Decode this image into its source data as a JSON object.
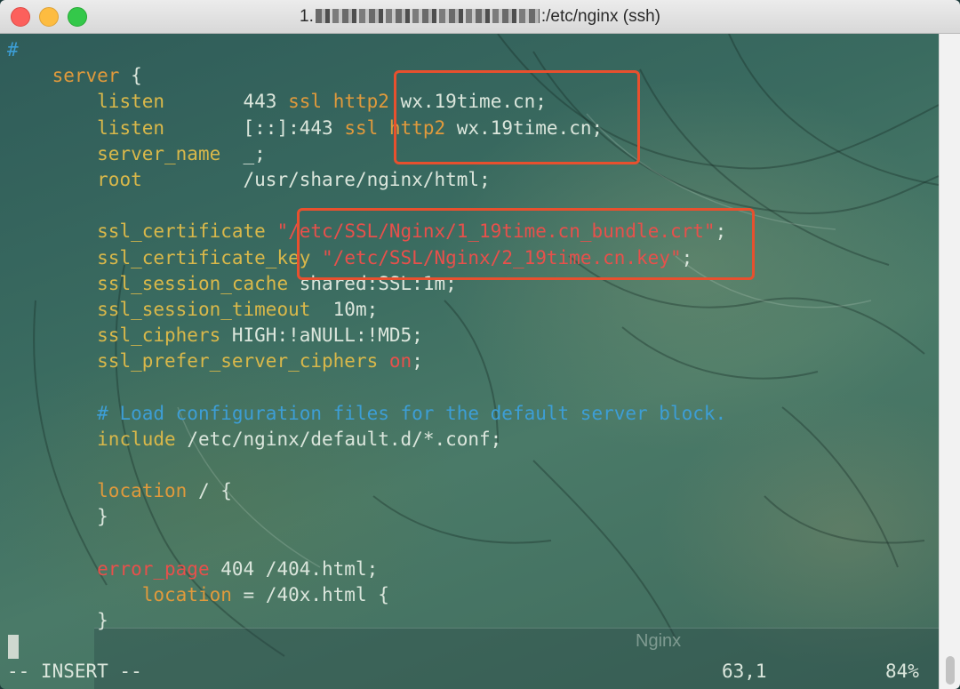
{
  "window": {
    "title_prefix": "1.",
    "title_suffix": ":/etc/nginx (ssh)"
  },
  "editor": {
    "lines": [
      [
        {
          "t": "#",
          "c": "hash"
        }
      ],
      [
        {
          "t": "    "
        },
        {
          "t": "server",
          "c": "kw"
        },
        {
          "t": " {"
        }
      ],
      [
        {
          "t": "        "
        },
        {
          "t": "listen",
          "c": "dir"
        },
        {
          "t": "       443 "
        },
        {
          "t": "ssl",
          "c": "kw"
        },
        {
          "t": " "
        },
        {
          "t": "http2",
          "c": "kw"
        },
        {
          "t": " wx.19time.cn;"
        }
      ],
      [
        {
          "t": "        "
        },
        {
          "t": "listen",
          "c": "dir"
        },
        {
          "t": "       [::]:443 "
        },
        {
          "t": "ssl",
          "c": "kw"
        },
        {
          "t": " "
        },
        {
          "t": "http2",
          "c": "kw"
        },
        {
          "t": " wx.19time.cn;"
        }
      ],
      [
        {
          "t": "        "
        },
        {
          "t": "server_name",
          "c": "dir"
        },
        {
          "t": "  _;"
        }
      ],
      [
        {
          "t": "        "
        },
        {
          "t": "root",
          "c": "dir"
        },
        {
          "t": "         /usr/share/nginx/html;"
        }
      ],
      [
        {
          "t": ""
        }
      ],
      [
        {
          "t": "        "
        },
        {
          "t": "ssl_certificate",
          "c": "dir"
        },
        {
          "t": " "
        },
        {
          "t": "\"/etc/SSL/Nginx/1_19time.cn_bundle.crt\"",
          "c": "str"
        },
        {
          "t": ";"
        }
      ],
      [
        {
          "t": "        "
        },
        {
          "t": "ssl_certificate_key",
          "c": "dir"
        },
        {
          "t": " "
        },
        {
          "t": "\"/etc/SSL/Nginx/2_19time.cn.key\"",
          "c": "str"
        },
        {
          "t": ";"
        }
      ],
      [
        {
          "t": "        "
        },
        {
          "t": "ssl_session_cache",
          "c": "dir"
        },
        {
          "t": " shared:SSL:1m;"
        }
      ],
      [
        {
          "t": "        "
        },
        {
          "t": "ssl_session_timeout",
          "c": "dir"
        },
        {
          "t": "  10m;"
        }
      ],
      [
        {
          "t": "        "
        },
        {
          "t": "ssl_ciphers",
          "c": "dir"
        },
        {
          "t": " HIGH:!aNULL:!MD5;"
        }
      ],
      [
        {
          "t": "        "
        },
        {
          "t": "ssl_prefer_server_ciphers",
          "c": "dir"
        },
        {
          "t": " "
        },
        {
          "t": "on",
          "c": "red"
        },
        {
          "t": ";"
        }
      ],
      [
        {
          "t": ""
        }
      ],
      [
        {
          "t": "        "
        },
        {
          "t": "# Load configuration files for the default server block.",
          "c": "cmt"
        }
      ],
      [
        {
          "t": "        "
        },
        {
          "t": "include",
          "c": "dir"
        },
        {
          "t": " /etc/nginx/default.d/*.conf;"
        }
      ],
      [
        {
          "t": ""
        }
      ],
      [
        {
          "t": "        "
        },
        {
          "t": "location",
          "c": "kw"
        },
        {
          "t": " / {"
        }
      ],
      [
        {
          "t": "        }"
        }
      ],
      [
        {
          "t": ""
        }
      ],
      [
        {
          "t": "        "
        },
        {
          "t": "error_page",
          "c": "red"
        },
        {
          "t": " 404 /404.html;"
        }
      ],
      [
        {
          "t": "            "
        },
        {
          "t": "location",
          "c": "kw"
        },
        {
          "t": " = /40x.html {"
        }
      ],
      [
        {
          "t": "        }"
        }
      ]
    ]
  },
  "overlay": {
    "folder_title": "Nginx"
  },
  "status": {
    "mode": "-- INSERT --",
    "position": "63,1",
    "percent": "84%"
  }
}
